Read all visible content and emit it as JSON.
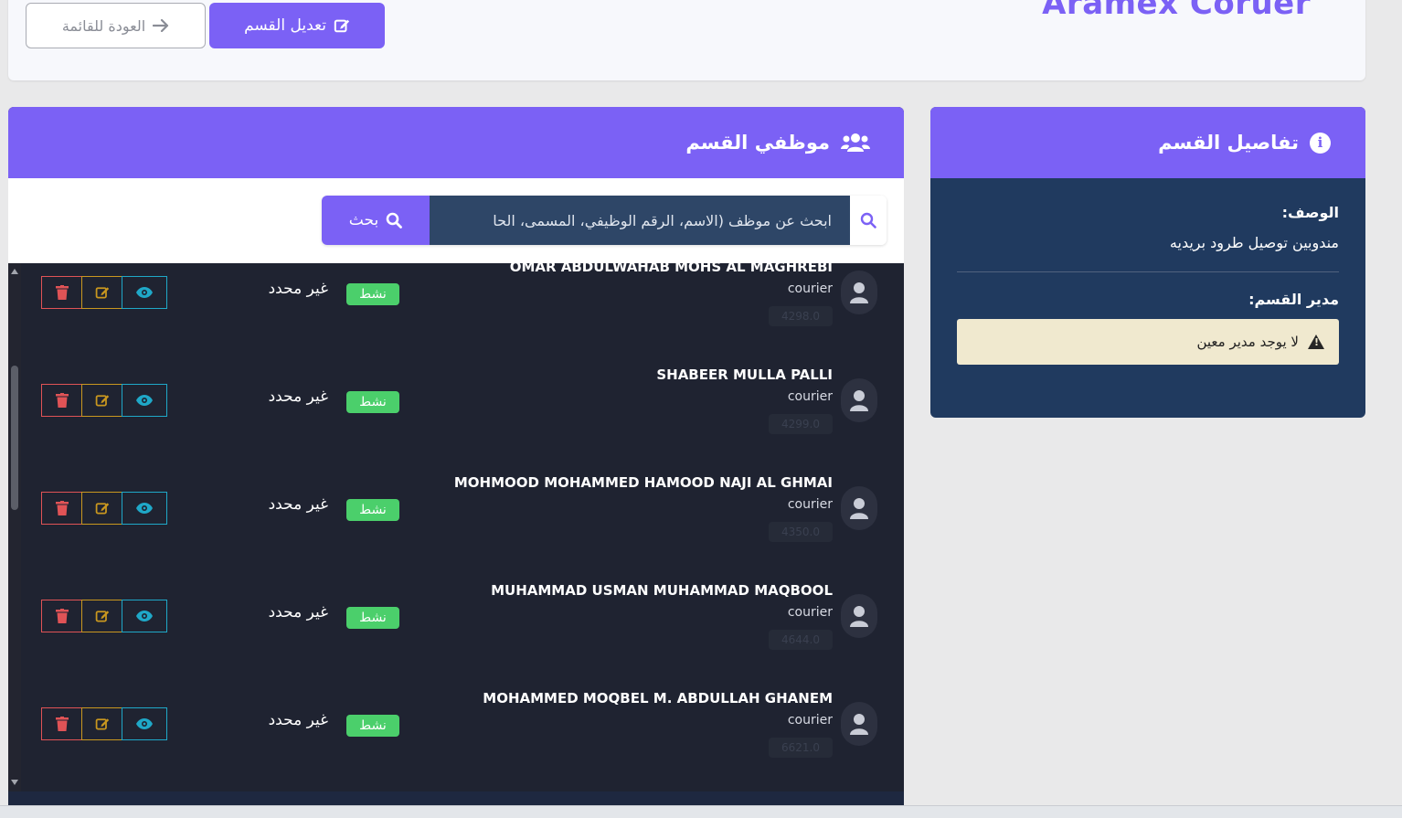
{
  "header": {
    "brand": "Aramex Coruer",
    "edit_button": "تعديل القسم",
    "back_button": "العودة للقائمة"
  },
  "details_panel": {
    "title": "تفاصيل القسم",
    "description_label": "الوصف:",
    "description_value": "مندوبين توصيل طرود بريديه",
    "manager_label": "مدير القسم:",
    "manager_alert": "لا يوجد مدير معين"
  },
  "employees_panel": {
    "title": "موظفي القسم",
    "search": {
      "placeholder": "ابحث عن موظف (الاسم، الرقم الوظيفي، المسمى، الحا",
      "button": "بحث"
    },
    "rows": [
      {
        "name": "OMAR ABDULWAHAB MOHS AL MAGHREBI",
        "role": "courier",
        "id": "4298.0",
        "status": "نشط",
        "manager": "غير محدد"
      },
      {
        "name": "SHABEER MULLA PALLI",
        "role": "courier",
        "id": "4299.0",
        "status": "نشط",
        "manager": "غير محدد"
      },
      {
        "name": "MOHMOOD MOHAMMED HAMOOD NAJI AL GHMAI",
        "role": "courier",
        "id": "4350.0",
        "status": "نشط",
        "manager": "غير محدد"
      },
      {
        "name": "MUHAMMAD USMAN MUHAMMAD MAQBOOL",
        "role": "courier",
        "id": "4644.0",
        "status": "نشط",
        "manager": "غير محدد"
      },
      {
        "name": "MOHAMMED MOQBEL M. ABDULLAH GHANEM",
        "role": "courier",
        "id": "6621.0",
        "status": "نشط",
        "manager": "غير محدد"
      }
    ]
  },
  "colors": {
    "accent": "#7b61f5",
    "panel_dark": "#203a5f",
    "list_bg": "#1f2331",
    "status_green": "#4bcf6b",
    "delete_red": "#e05356",
    "edit_gold": "#c9971f",
    "view_cyan": "#1fa8c8"
  },
  "icons": {
    "edit_button": "pen-square-icon",
    "back_button": "arrow-right-icon",
    "details_title": "info-circle-icon",
    "employees_title": "users-icon",
    "manager_alert": "warning-triangle-icon",
    "search": "search-icon",
    "avatar": "user-icon",
    "row_actions": [
      "trash-icon",
      "edit-icon",
      "eye-icon"
    ]
  }
}
